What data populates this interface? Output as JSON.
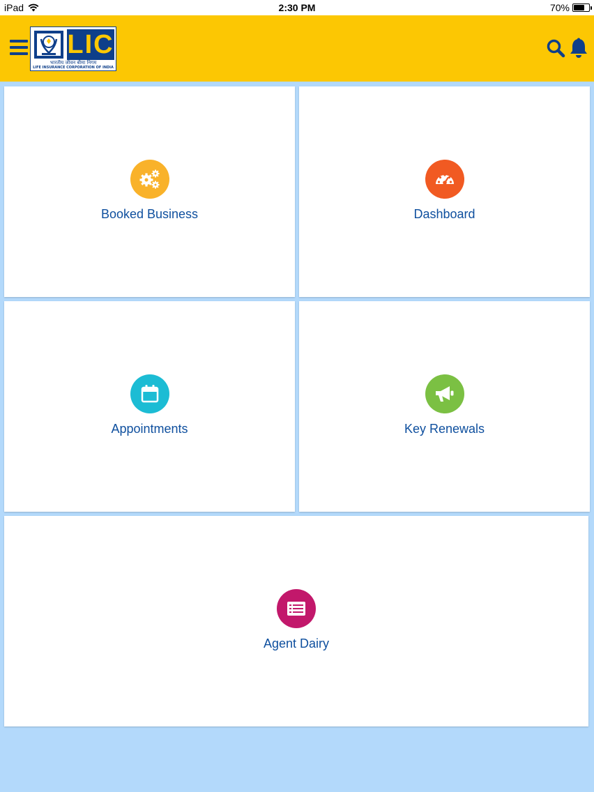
{
  "status_bar": {
    "device": "iPad",
    "time": "2:30 PM",
    "battery": "70%",
    "battery_level": 0.7
  },
  "header": {
    "logo_text": "LIC",
    "logo_hindi": "भारतीय जीवन बीमा निगम",
    "logo_english": "LIFE INSURANCE CORPORATION OF INDIA",
    "menu_icon": "hamburger-menu-icon",
    "search_icon": "search-icon",
    "bell_icon": "bell-icon"
  },
  "tiles": [
    {
      "label": "Booked Business",
      "icon": "gears-icon",
      "color": "#f9b22a"
    },
    {
      "label": "Dashboard",
      "icon": "speedometer-icon",
      "color": "#f15a22"
    },
    {
      "label": "Appointments",
      "icon": "calendar-icon",
      "color": "#1cbcd4"
    },
    {
      "label": "Key Renewals",
      "icon": "megaphone-icon",
      "color": "#7bc043"
    },
    {
      "label": "Agent Dairy",
      "icon": "list-icon",
      "color": "#c2186b"
    }
  ],
  "colors": {
    "header_bg": "#fcc703",
    "page_bg": "#b3d9fb",
    "brand_blue": "#0e3f8a",
    "label_text": "#0e4f9e"
  }
}
